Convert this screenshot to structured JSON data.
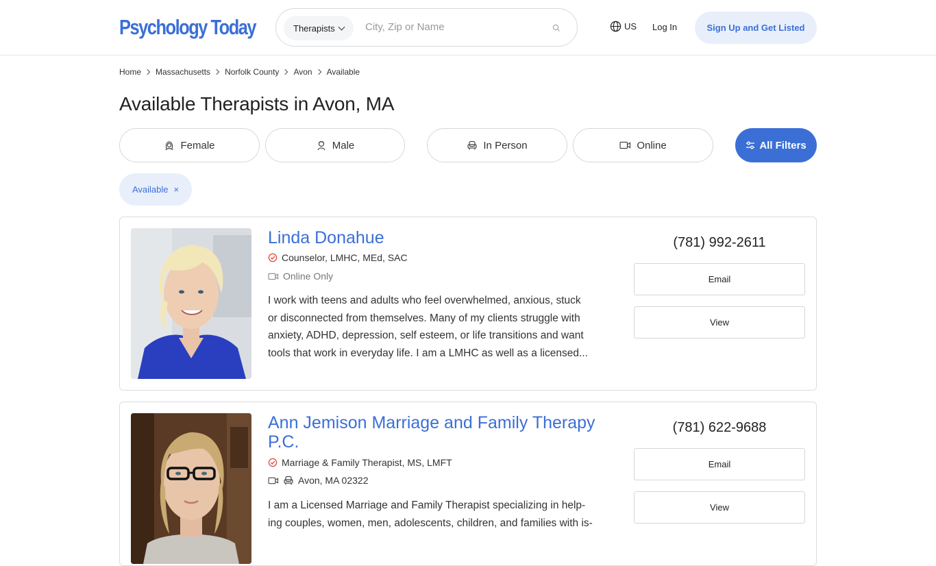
{
  "header": {
    "logo": "Psychology Today",
    "search_type": "Therapists",
    "search_placeholder": "City, Zip or Name",
    "locale": "US",
    "login": "Log In",
    "signup": "Sign Up and Get Listed"
  },
  "breadcrumb": [
    "Home",
    "Massachusetts",
    "Norfolk County",
    "Avon",
    "Available"
  ],
  "page_title": "Available Therapists in Avon, MA",
  "filters": {
    "female": "Female",
    "male": "Male",
    "in_person": "In Person",
    "online": "Online",
    "all": "All Filters"
  },
  "active_chip": {
    "label": "Available",
    "remove": "×"
  },
  "listings": [
    {
      "name": "Linda Donahue",
      "credentials": "Counselor, LMHC, MEd, SAC",
      "mode": "Online Only",
      "bio": [
        "I work with teens and adults who feel overwhelmed, anxious, stuck",
        "or disconnected from themselves. Many of my clients struggle with",
        "anxiety, ADHD, depression, self esteem, or life transitions and want",
        "tools that work in everyday life. I am a LMHC as well as a licensed..."
      ],
      "phone": "(781) 992-2611",
      "email": "Email",
      "view": "View"
    },
    {
      "name": "Ann Jemison Marriage and Family Therapy P.C.",
      "credentials": "Marriage & Family Therapist, MS, LMFT",
      "location": "Avon, MA 02322",
      "bio": [
        "I am a Licensed Marriage and Family Therapist specializing in help-",
        "ing couples, women, men, adolescents, children, and families with is-"
      ],
      "phone": "(781) 622-9688",
      "email": "Email",
      "view": "View"
    }
  ],
  "colors": {
    "brand": "#3b6fd6",
    "chip_bg": "#e8effb",
    "verified": "#e0463a"
  }
}
